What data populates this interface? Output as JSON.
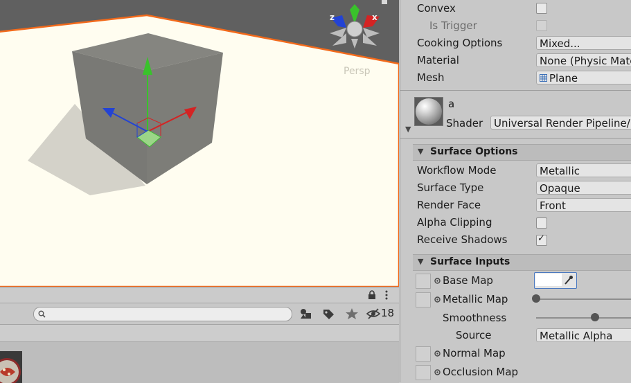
{
  "scene": {
    "persp_label": "Persp",
    "gizmo": {
      "z": "z",
      "x": "x"
    }
  },
  "lower_panel": {
    "search_placeholder": "",
    "hidden_count": "18"
  },
  "inspector": {
    "collider": {
      "convex_label": "Convex",
      "convex_checked": false,
      "is_trigger_label": "Is Trigger",
      "is_trigger_checked": false,
      "cooking_options_label": "Cooking Options",
      "cooking_options_value": "Mixed...",
      "material_label": "Material",
      "material_value": "None (Physic Material)",
      "mesh_label": "Mesh",
      "mesh_value": "Plane"
    },
    "material_header": {
      "name": "a",
      "shader_label": "Shader",
      "shader_value": "Universal Render Pipeline/Lit"
    },
    "surface_options": {
      "title": "Surface Options",
      "workflow_mode_label": "Workflow Mode",
      "workflow_mode_value": "Metallic",
      "surface_type_label": "Surface Type",
      "surface_type_value": "Opaque",
      "render_face_label": "Render Face",
      "render_face_value": "Front",
      "alpha_clipping_label": "Alpha Clipping",
      "alpha_clipping_checked": false,
      "receive_shadows_label": "Receive Shadows",
      "receive_shadows_checked": true
    },
    "surface_inputs": {
      "title": "Surface Inputs",
      "base_map_label": "Base Map",
      "base_map_color": "#ffffff",
      "metallic_map_label": "Metallic Map",
      "metallic_value": 0.0,
      "smoothness_label": "Smoothness",
      "smoothness_value": 0.5,
      "source_label": "Source",
      "source_value": "Metallic Alpha",
      "normal_map_label": "Normal Map",
      "occlusion_map_label": "Occlusion Map"
    }
  },
  "colors": {
    "selection_outline": "#f26a1b",
    "ground": "#fffdf0",
    "axis_x": "#d42323",
    "axis_y": "#39c22b",
    "axis_z": "#2343d4"
  }
}
